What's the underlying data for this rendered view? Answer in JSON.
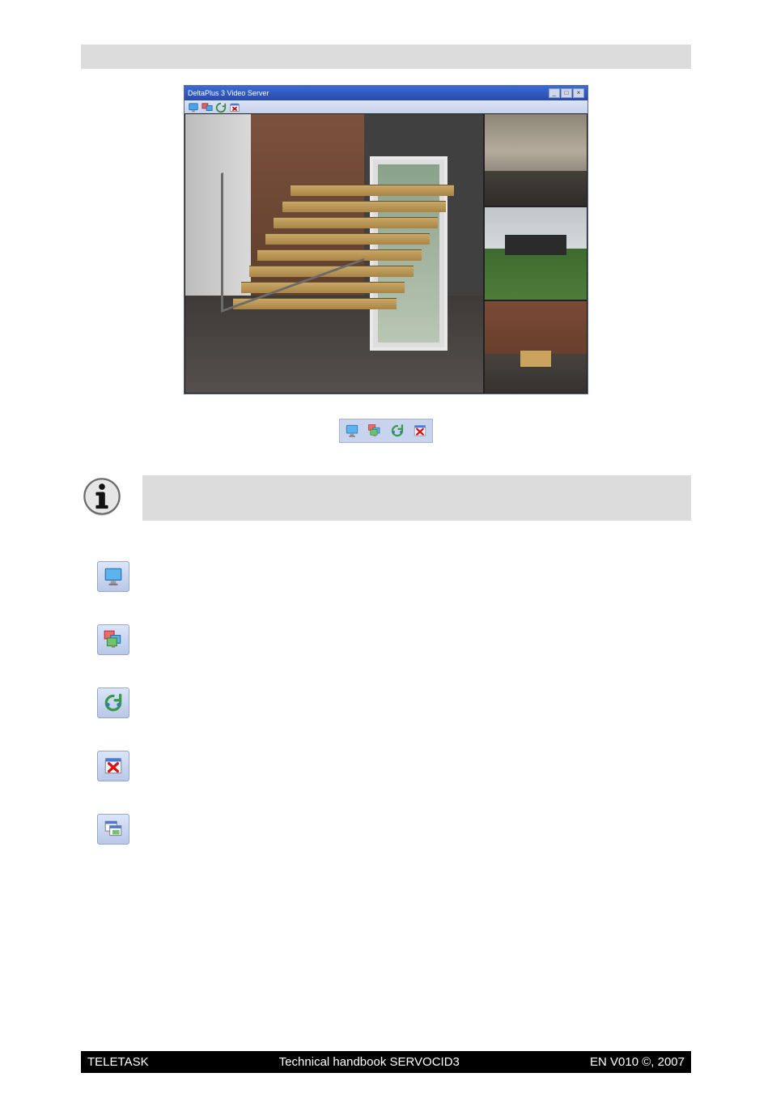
{
  "section_bar_label": "",
  "app_window": {
    "title": "DeltaPlus 3 Video Server",
    "window_controls": [
      "_",
      "□",
      "×"
    ]
  },
  "info_note": "",
  "toolbar_icons": [
    {
      "id": "single-monitor-icon",
      "name": "single-monitor"
    },
    {
      "id": "multi-monitor-icon",
      "name": "multi-monitor"
    },
    {
      "id": "cycle-icon",
      "name": "cycle"
    },
    {
      "id": "close-picture-icon",
      "name": "close-picture"
    }
  ],
  "icon_descriptions": [
    {
      "id": "single-monitor-icon",
      "label": ""
    },
    {
      "id": "multi-monitor-icon",
      "label": ""
    },
    {
      "id": "cycle-icon",
      "label": ""
    },
    {
      "id": "close-picture-icon",
      "label": ""
    },
    {
      "id": "cascade-icon",
      "label": ""
    }
  ],
  "footer": {
    "left": "TELETASK",
    "center": "Technical handbook SERVOCID3",
    "right": "EN V010 ©, 2007"
  }
}
